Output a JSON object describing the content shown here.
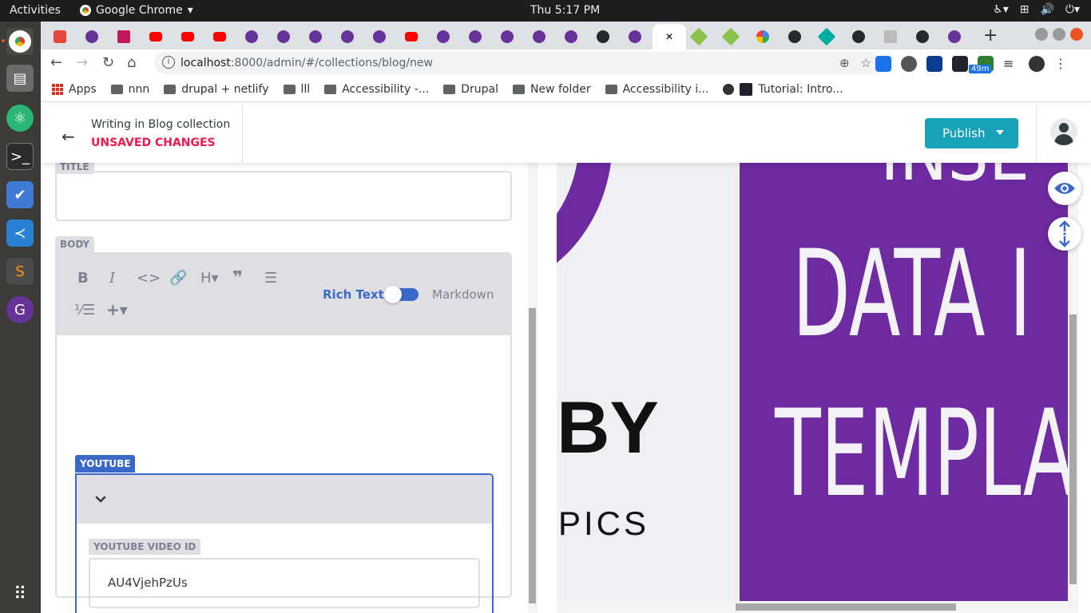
{
  "system": {
    "activities": "Activities",
    "app_name": "Google Chrome",
    "clock": "Thu  5:17 PM"
  },
  "browser": {
    "url_host": "localhost",
    "url_path": ":8000/admin/#/collections/blog/new",
    "badge": "49m",
    "bookmarks": [
      "Apps",
      "nnn",
      "drupal + netlify",
      "lll",
      "Accessibility -...",
      "Drupal",
      "New folder",
      "Accessibility i...",
      "Tutorial: Intro..."
    ]
  },
  "cms": {
    "header": {
      "writing": "Writing in Blog collection",
      "unsaved": "UNSAVED CHANGES",
      "publish": "Publish"
    },
    "fields": {
      "title_label": "TITLE",
      "body_label": "BODY",
      "rich_text": "Rich Text",
      "markdown": "Markdown",
      "youtube_label": "YOUTUBE",
      "video_id_label": "YOUTUBE VIDEO ID",
      "video_id_value": "AU4VjehPzUs"
    }
  },
  "preview": {
    "text_top": "INSE",
    "text_data": "DATA I",
    "text_templa": "TEMPLA",
    "text_by": "BY",
    "text_pics": "PICS"
  },
  "colors": {
    "accent_blue": "#3a69c7",
    "publish_teal": "#17a2b8",
    "unsaved_red": "#ed1a4b",
    "preview_purple": "#6e2aa0"
  }
}
